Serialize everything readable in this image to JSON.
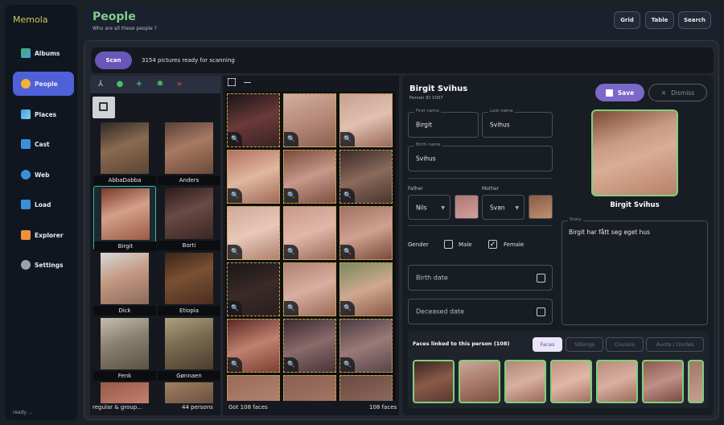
{
  "app": {
    "name": "Memola",
    "status": "ready ..."
  },
  "sidebar": {
    "items": [
      {
        "label": "Albums",
        "icon": "albums-icon",
        "active": false
      },
      {
        "label": "People",
        "icon": "people-icon",
        "active": true
      },
      {
        "label": "Places",
        "icon": "places-icon",
        "active": false
      },
      {
        "label": "Cast",
        "icon": "cast-icon",
        "active": false
      },
      {
        "label": "Web",
        "icon": "web-icon",
        "active": false
      },
      {
        "label": "Load",
        "icon": "load-icon",
        "active": false
      },
      {
        "label": "Explorer",
        "icon": "explorer-icon",
        "active": false
      },
      {
        "label": "Settings",
        "icon": "settings-icon",
        "active": false
      }
    ]
  },
  "header": {
    "title": "People",
    "subtitle": "Who are all these people ?",
    "buttons": [
      "Grid",
      "Table",
      "Search"
    ]
  },
  "scan": {
    "button": "Scan",
    "status": "3154 pictures ready for scanning"
  },
  "people": {
    "list": [
      {
        "name": "AbbaDabba"
      },
      {
        "name": "Anders"
      },
      {
        "name": "Birgit",
        "selected": true
      },
      {
        "name": "Borti"
      },
      {
        "name": "Dick"
      },
      {
        "name": "Etiopia"
      },
      {
        "name": "Fenk"
      },
      {
        "name": "Gønnaen"
      }
    ],
    "footer_left": "regular & group...",
    "footer_right": "44 persons"
  },
  "faces": {
    "footer_left": "Got 108 faces",
    "footer_right": "108 faces"
  },
  "detail": {
    "name": "Birgit Svihus",
    "person_id": "Person ID 1007",
    "first_name_label": "First name",
    "first_name": "Birgit",
    "last_name_label": "Last name",
    "last_name": "Svihus",
    "birth_name_label": "Birth name",
    "birth_name": "Svihus",
    "father_label": "Father",
    "father": "Nils",
    "mother_label": "Mother",
    "mother": "Svan",
    "gender_label": "Gender",
    "male_label": "Male",
    "female_label": "Female",
    "gender_value": "Female",
    "birth_date_placeholder": "Birth date",
    "deceased_date_placeholder": "Deceased date",
    "save": "Save",
    "dismiss": "Dismiss",
    "portrait_name": "Birgit Svihus",
    "story_label": "Story",
    "story": "Birgit har fått seg eget hus"
  },
  "linked": {
    "title": "Faces linked to this person (108)",
    "tabs": [
      {
        "label": "Faces",
        "active": true
      },
      {
        "label": "Siblings",
        "active": false
      },
      {
        "label": "Cousins",
        "active": false
      },
      {
        "label": "Aunts / Uncles",
        "active": false
      }
    ]
  },
  "colors": {
    "accent": "#4f61d8",
    "purple": "#6a56b8",
    "green": "#7ed07a",
    "title_green": "#7fd08a"
  }
}
